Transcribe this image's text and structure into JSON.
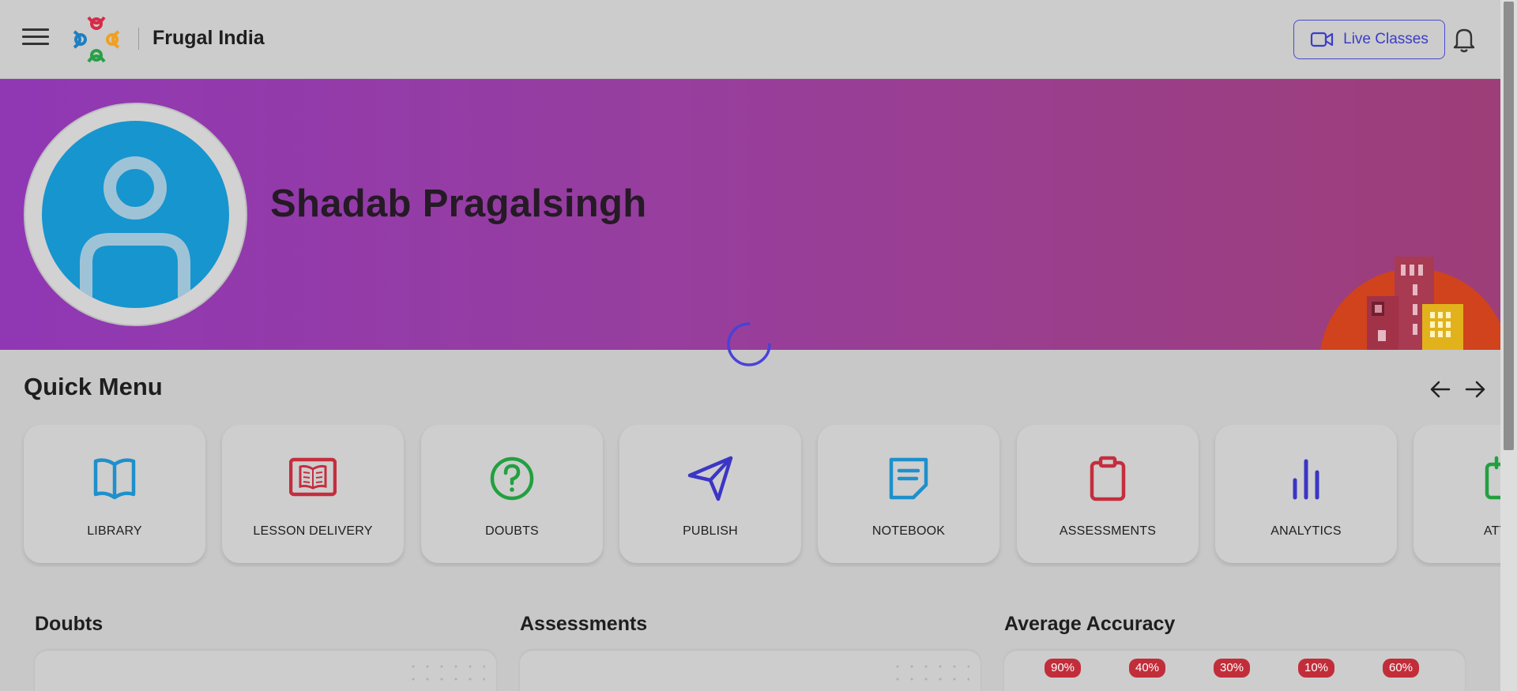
{
  "header": {
    "brand": "Frugal India",
    "live_classes_label": "Live Classes"
  },
  "profile": {
    "name": "Shadab Pragalsingh"
  },
  "quick_menu": {
    "title": "Quick Menu",
    "items": [
      {
        "label": "LIBRARY",
        "icon": "book-open-icon",
        "color": "#1e90cc"
      },
      {
        "label": "LESSON DELIVERY",
        "icon": "lesson-board-icon",
        "color": "#c42e3e"
      },
      {
        "label": "DOUBTS",
        "icon": "question-circle-icon",
        "color": "#22a040"
      },
      {
        "label": "PUBLISH",
        "icon": "send-icon",
        "color": "#3b36c4"
      },
      {
        "label": "NOTEBOOK",
        "icon": "note-icon",
        "color": "#1e90cc"
      },
      {
        "label": "ASSESSMENTS",
        "icon": "clipboard-icon",
        "color": "#c42e3e"
      },
      {
        "label": "ANALYTICS",
        "icon": "bar-chart-icon",
        "color": "#3b36c4"
      },
      {
        "label": "ATTEN",
        "icon": "calendar-icon",
        "color": "#22a040"
      }
    ]
  },
  "sections": {
    "doubts_title": "Doubts",
    "assessments_title": "Assessments",
    "accuracy_title": "Average Accuracy",
    "accuracy_values": [
      "90%",
      "40%",
      "30%",
      "10%",
      "60%"
    ]
  },
  "colors": {
    "accent": "#3c3cc8",
    "banner_start": "#9038b4",
    "banner_end": "#9d3e78",
    "avatar_bg": "#1795cf"
  }
}
